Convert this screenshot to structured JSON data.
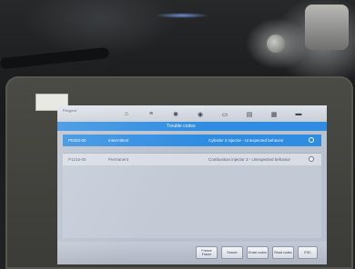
{
  "device_label": "",
  "screen": {
    "header": {
      "title": "Peugeot",
      "subtitle": ""
    },
    "toolbar_icons": [
      "home-icon",
      "settings-icon",
      "gear-icon",
      "camera-icon",
      "car-icon",
      "print-icon",
      "folder-icon",
      "message-icon"
    ],
    "panel": {
      "title": "Trouble codes",
      "info": ""
    },
    "codes": [
      {
        "code": "P0202-00",
        "status": "Intermittent",
        "description": "Cylinder 2 injector - Unexpected behavior"
      },
      {
        "code": "P1215-00",
        "status": "Permanent",
        "description": "Combustion injector 3 - Unexpected behavior"
      }
    ],
    "footer": {
      "info_lines": [
        "",
        "",
        ""
      ],
      "buttons": [
        "Freeze Frame",
        "Search",
        "Erase codes",
        "Read codes",
        "ESC"
      ]
    }
  }
}
